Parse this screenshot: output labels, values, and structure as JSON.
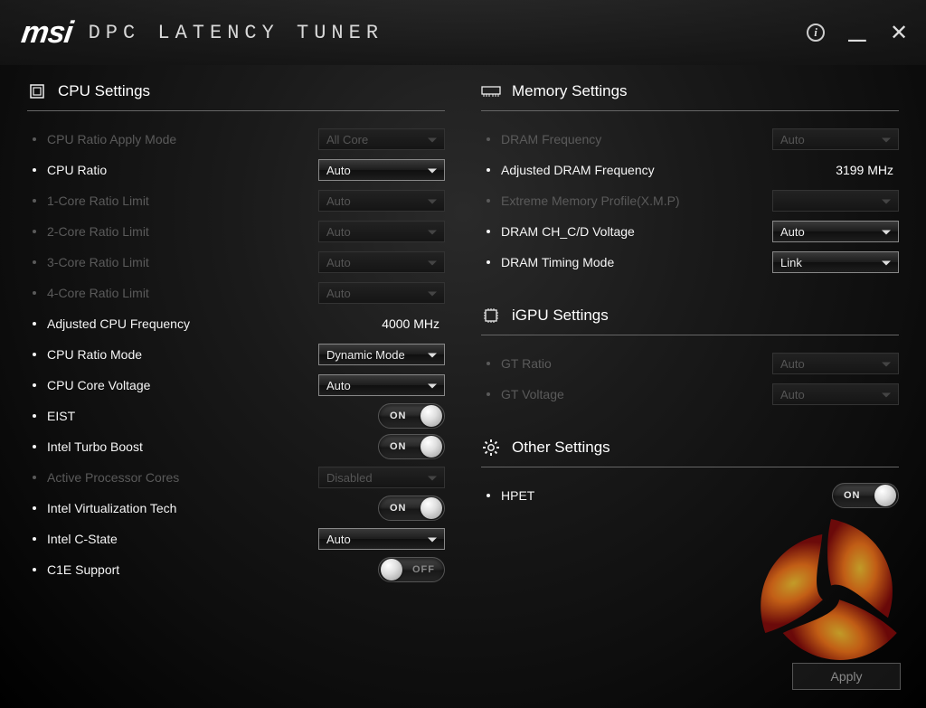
{
  "header": {
    "brand": "msi",
    "title": "DPC LATENCY TUNER"
  },
  "sections": {
    "cpu": {
      "title": "CPU Settings",
      "items": [
        {
          "label": "CPU Ratio Apply Mode",
          "kind": "dropdown",
          "value": "All Core",
          "enabled": false
        },
        {
          "label": "CPU Ratio",
          "kind": "dropdown",
          "value": "Auto",
          "enabled": true
        },
        {
          "label": "1-Core Ratio Limit",
          "kind": "dropdown",
          "value": "Auto",
          "enabled": false
        },
        {
          "label": "2-Core Ratio Limit",
          "kind": "dropdown",
          "value": "Auto",
          "enabled": false
        },
        {
          "label": "3-Core Ratio Limit",
          "kind": "dropdown",
          "value": "Auto",
          "enabled": false
        },
        {
          "label": "4-Core Ratio Limit",
          "kind": "dropdown",
          "value": "Auto",
          "enabled": false
        },
        {
          "label": "Adjusted CPU Frequency",
          "kind": "readout",
          "value": "4000 MHz",
          "enabled": true
        },
        {
          "label": "CPU Ratio Mode",
          "kind": "dropdown",
          "value": "Dynamic Mode",
          "enabled": true
        },
        {
          "label": "CPU Core Voltage",
          "kind": "dropdown",
          "value": "Auto",
          "enabled": true
        },
        {
          "label": "EIST",
          "kind": "toggle",
          "value": "ON",
          "enabled": true
        },
        {
          "label": "Intel Turbo Boost",
          "kind": "toggle",
          "value": "ON",
          "enabled": true
        },
        {
          "label": "Active Processor Cores",
          "kind": "dropdown",
          "value": "Disabled",
          "enabled": false
        },
        {
          "label": "Intel Virtualization Tech",
          "kind": "toggle",
          "value": "ON",
          "enabled": true
        },
        {
          "label": "Intel C-State",
          "kind": "dropdown",
          "value": "Auto",
          "enabled": true
        },
        {
          "label": "C1E Support",
          "kind": "toggle",
          "value": "OFF",
          "enabled": true
        }
      ]
    },
    "memory": {
      "title": "Memory Settings",
      "items": [
        {
          "label": "DRAM Frequency",
          "kind": "dropdown",
          "value": "Auto",
          "enabled": false
        },
        {
          "label": "Adjusted DRAM Frequency",
          "kind": "readout",
          "value": "3199 MHz",
          "enabled": true
        },
        {
          "label": "Extreme Memory Profile(X.M.P)",
          "kind": "dropdown",
          "value": "",
          "enabled": false
        },
        {
          "label": "DRAM CH_C/D Voltage",
          "kind": "dropdown",
          "value": "Auto",
          "enabled": true
        },
        {
          "label": "DRAM Timing Mode",
          "kind": "dropdown",
          "value": "Link",
          "enabled": true
        }
      ]
    },
    "igpu": {
      "title": "iGPU Settings",
      "items": [
        {
          "label": "GT Ratio",
          "kind": "dropdown",
          "value": "Auto",
          "enabled": false
        },
        {
          "label": "GT Voltage",
          "kind": "dropdown",
          "value": "Auto",
          "enabled": false
        }
      ]
    },
    "other": {
      "title": "Other Settings",
      "items": [
        {
          "label": "HPET",
          "kind": "toggle",
          "value": "ON",
          "enabled": true
        }
      ]
    }
  },
  "footer": {
    "apply": "Apply"
  }
}
